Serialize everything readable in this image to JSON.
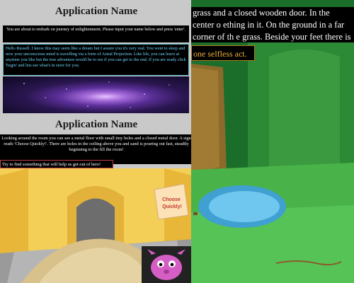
{
  "left_top": {
    "app_title": "Application Name",
    "intro_text": "You are about to embark on journey of enlightenment. Please input your name below and press 'enter'.",
    "story_text": "Hello Russell. I know this may seem like a dream but I assure you it's very real. You went to sleep and now your unconscious mind is travelling via a form of Astral Projection. Like life, you can leave at anytime you like but the true adventure would be to see if you can get to the end. If you are ready click 'begin' and lets see what's in store for you."
  },
  "left_bottom": {
    "app_title": "Application Name",
    "story_text": "Looking around the room you can see a metal floor with small tiny holes and a closed metal door. A sign reads 'Choose Quickly!'. There are holes in the ceiling above you and sand is pouring out fast, steadily beginning to the fill the room!",
    "choice_text": "Try to find something that will help us get out of here!",
    "sign_text_line1": "Choose",
    "sign_text_line2": "Quickly!"
  },
  "right": {
    "story_text": "grass and a closed wooden door. In the center o ething in it. On the ground in a far corner of th e grass. Beside your feet there is a stick.",
    "choice_text": "one selfless act."
  },
  "colors": {
    "forest": "#1c7b2f",
    "sand": "#f2c94c",
    "sign_text": "#c0392b"
  }
}
